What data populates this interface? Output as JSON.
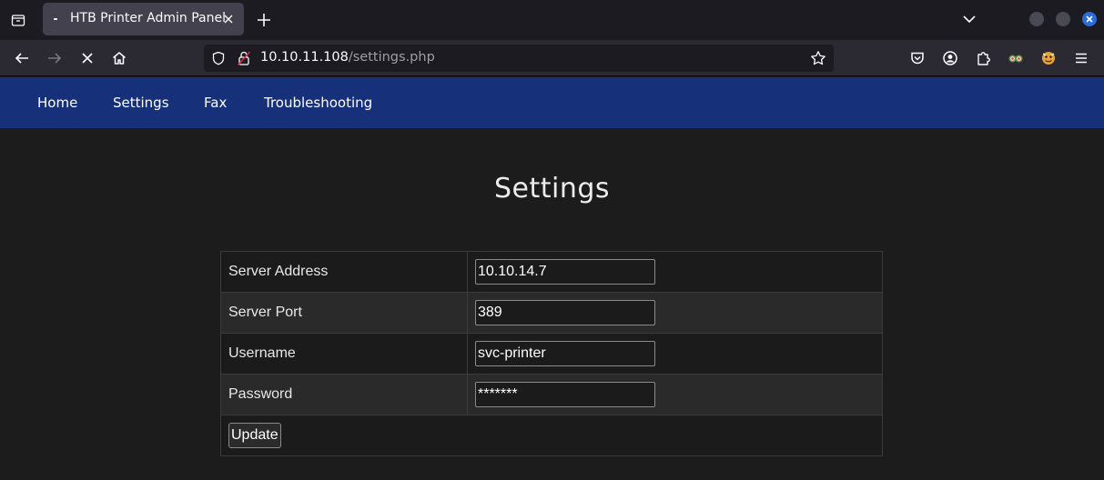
{
  "browser": {
    "tab_title": "HTB Printer Admin Panel",
    "url_host": "10.10.11.108",
    "url_path": "/settings.php"
  },
  "site_nav": {
    "items": [
      {
        "label": "Home"
      },
      {
        "label": "Settings"
      },
      {
        "label": "Fax"
      },
      {
        "label": "Troubleshooting"
      }
    ]
  },
  "page": {
    "title": "Settings"
  },
  "settings_form": {
    "rows": [
      {
        "label": "Server Address",
        "value": "10.10.14.7"
      },
      {
        "label": "Server Port",
        "value": "389"
      },
      {
        "label": "Username",
        "value": "svc-printer"
      },
      {
        "label": "Password",
        "value": "*******"
      }
    ],
    "submit_label": "Update"
  },
  "icons": {
    "tab_list": "tab-list-icon",
    "close_tab": "close-icon",
    "new_tab": "plus-icon",
    "tab_overflow": "chevron-down-icon",
    "back": "back-arrow-icon",
    "forward": "forward-arrow-icon",
    "stop": "stop-icon",
    "home": "home-icon",
    "shield": "shield-icon",
    "insecure": "insecure-lock-icon",
    "bookmark": "star-icon",
    "pocket": "pocket-icon",
    "account": "account-icon",
    "extensions": "extensions-icon",
    "extension_1": "extension-icon",
    "extension_2": "extension-icon",
    "menu": "hamburger-menu-icon"
  },
  "colors": {
    "site_nav_bg": "#16307a",
    "page_bg": "#1c1c1c",
    "close_window": "#2a6cd8"
  }
}
